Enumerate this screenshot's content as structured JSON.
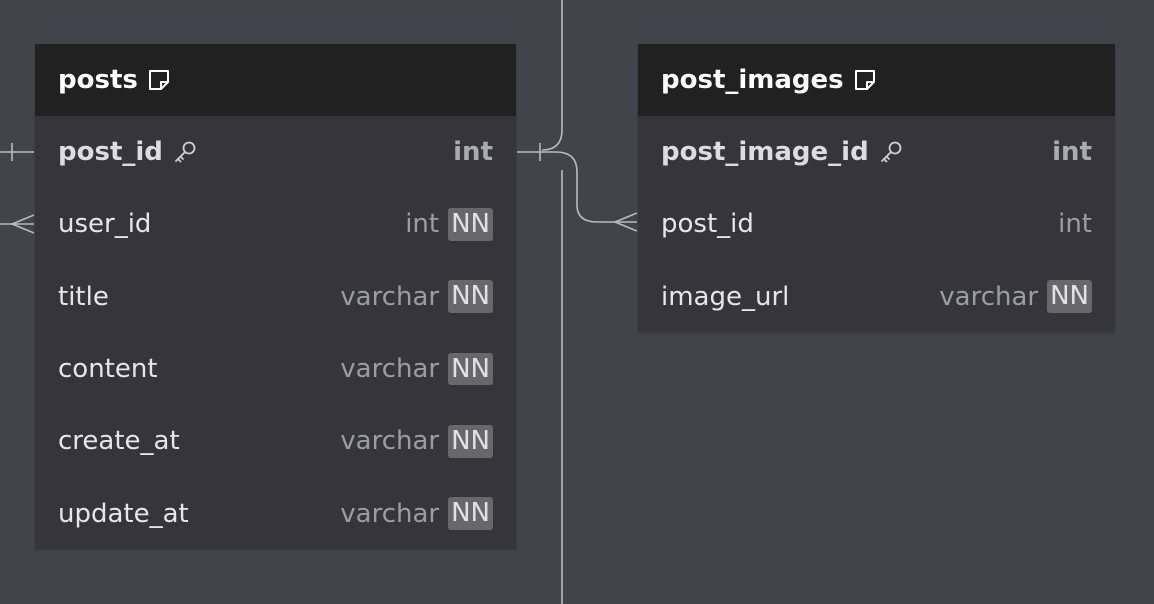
{
  "colors": {
    "canvas_bg": "#43434c",
    "header_bg": "#212121",
    "body_bg": "#35353b",
    "connector": "#b9b9c1",
    "badge_bg": "#67676c"
  },
  "tables": [
    {
      "name": "posts",
      "columns": [
        {
          "name": "post_id",
          "type": "int",
          "pk": true,
          "nn": false
        },
        {
          "name": "user_id",
          "type": "int",
          "pk": false,
          "nn": true
        },
        {
          "name": "title",
          "type": "varchar",
          "pk": false,
          "nn": true
        },
        {
          "name": "content",
          "type": "varchar",
          "pk": false,
          "nn": true
        },
        {
          "name": "create_at",
          "type": "varchar",
          "pk": false,
          "nn": true
        },
        {
          "name": "update_at",
          "type": "varchar",
          "pk": false,
          "nn": true
        }
      ]
    },
    {
      "name": "post_images",
      "columns": [
        {
          "name": "post_image_id",
          "type": "int",
          "pk": true,
          "nn": false
        },
        {
          "name": "post_id",
          "type": "int",
          "pk": false,
          "nn": false
        },
        {
          "name": "image_url",
          "type": "varchar",
          "pk": false,
          "nn": true
        }
      ]
    }
  ],
  "nn_label": "NN",
  "icons": {
    "note": "note-icon",
    "key": "key-icon"
  },
  "relations": [
    {
      "from": "posts.post_id",
      "to": "post_images.post_id",
      "cardinality": "one-to-many"
    },
    {
      "from": "external",
      "to": "posts.post_id",
      "cardinality": "one"
    },
    {
      "from": "external",
      "to": "posts.user_id",
      "cardinality": "many"
    }
  ]
}
